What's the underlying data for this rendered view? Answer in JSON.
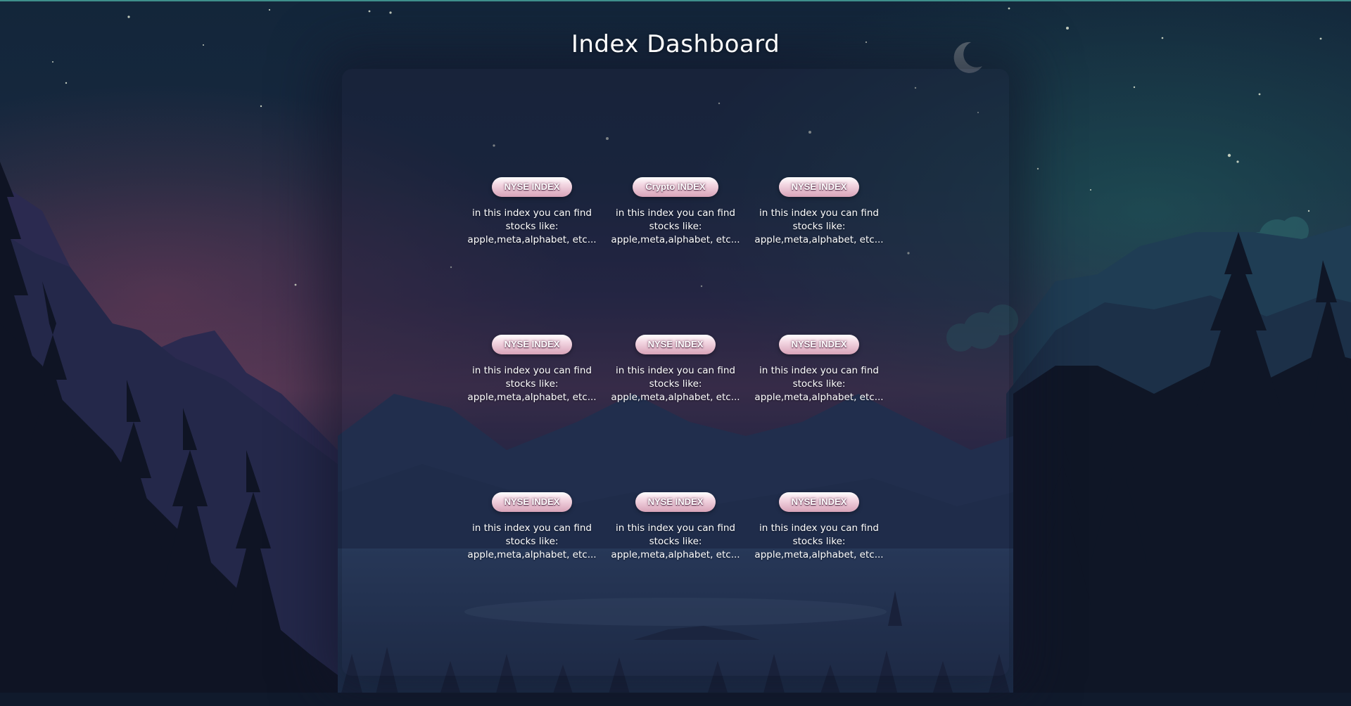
{
  "page": {
    "title": "Index Dashboard"
  },
  "theme": {
    "accent": "#3f8f8c",
    "pill_top": "#ffffff",
    "pill_bottom": "#d8a3b8",
    "text": "#ffffff"
  },
  "cards": [
    {
      "button_label": "NYSE INDEX",
      "description": "in this index you can find stocks like: apple,meta,alphabet, etc..."
    },
    {
      "button_label": "Crypto INDEX",
      "description": "in this index you can find stocks like: apple,meta,alphabet, etc..."
    },
    {
      "button_label": "NYSE INDEX",
      "description": "in this index you can find stocks like: apple,meta,alphabet, etc..."
    },
    {
      "button_label": "NYSE INDEX",
      "description": "in this index you can find stocks like: apple,meta,alphabet, etc..."
    },
    {
      "button_label": "NYSE INDEX",
      "description": "in this index you can find stocks like: apple,meta,alphabet, etc..."
    },
    {
      "button_label": "NYSE INDEX",
      "description": "in this index you can find stocks like: apple,meta,alphabet, etc..."
    },
    {
      "button_label": "NYSE INDEX",
      "description": "in this index you can find stocks like: apple,meta,alphabet, etc..."
    },
    {
      "button_label": "NYSE INDEX",
      "description": "in this index you can find stocks like: apple,meta,alphabet, etc..."
    },
    {
      "button_label": "NYSE INDEX",
      "description": "in this index you can find stocks like: apple,meta,alphabet, etc..."
    }
  ]
}
